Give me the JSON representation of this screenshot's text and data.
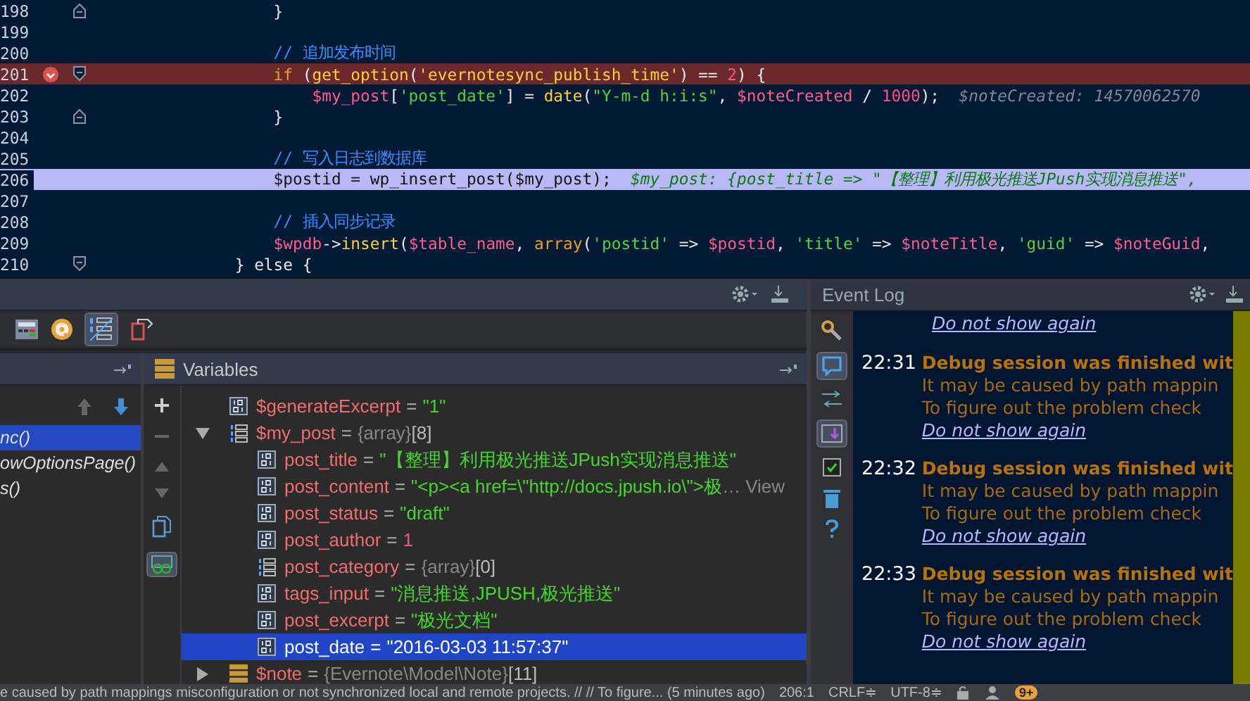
{
  "editor": {
    "lines": [
      {
        "number": "198",
        "breakpoint": false,
        "current": false,
        "fold_open": false,
        "fold_close": true,
        "tokens": [
          {
            "kind": "plain",
            "text": "            }"
          }
        ]
      },
      {
        "number": "199",
        "breakpoint": false,
        "current": false,
        "fold_open": false,
        "fold_close": false
      },
      {
        "number": "200",
        "breakpoint": false,
        "current": false,
        "fold_open": false,
        "fold_close": false,
        "tokens": [
          {
            "kind": "comment",
            "text": "            // 追加发布时间"
          }
        ]
      },
      {
        "number": "201",
        "breakpoint": true,
        "current": false,
        "fold_open": true,
        "fold_close": false,
        "tokens": [
          {
            "kind": "keyword",
            "text": "            if"
          },
          {
            "kind": "plain",
            "text": " ("
          },
          {
            "kind": "func",
            "text": "get_option"
          },
          {
            "kind": "plain",
            "text": "("
          },
          {
            "kind": "func",
            "text": "'evernotesync_publish_time'"
          },
          {
            "kind": "plain",
            "text": ") == "
          },
          {
            "kind": "number",
            "text": "2"
          },
          {
            "kind": "plain",
            "text": ") {"
          }
        ]
      },
      {
        "number": "202",
        "breakpoint": false,
        "current": false,
        "fold_open": false,
        "fold_close": false,
        "tokens": [
          {
            "kind": "var",
            "text": "                $my_post"
          },
          {
            "kind": "plain",
            "text": "["
          },
          {
            "kind": "string",
            "text": "'post_date'"
          },
          {
            "kind": "plain",
            "text": "] = "
          },
          {
            "kind": "func",
            "text": "date"
          },
          {
            "kind": "plain",
            "text": "("
          },
          {
            "kind": "string",
            "text": "\"Y-m-d h:i:s\""
          },
          {
            "kind": "plain",
            "text": ", "
          },
          {
            "kind": "var",
            "text": "$noteCreated"
          },
          {
            "kind": "plain",
            "text": " / "
          },
          {
            "kind": "number",
            "text": "1000"
          },
          {
            "kind": "plain",
            "text": ");"
          },
          {
            "kind": "hint",
            "text": "  $noteCreated: 14570062570"
          }
        ]
      },
      {
        "number": "203",
        "breakpoint": false,
        "current": false,
        "fold_open": false,
        "fold_close": true,
        "tokens": [
          {
            "kind": "plain",
            "text": "            }"
          }
        ]
      },
      {
        "number": "204",
        "breakpoint": false,
        "current": false,
        "fold_open": false,
        "fold_close": false
      },
      {
        "number": "205",
        "breakpoint": false,
        "current": false,
        "fold_open": false,
        "fold_close": false,
        "tokens": [
          {
            "kind": "comment",
            "text": "            // 写入日志到数据库"
          }
        ]
      },
      {
        "number": "206",
        "breakpoint": false,
        "current": true,
        "fold_open": false,
        "fold_close": false,
        "tokens": [
          {
            "kind": "plain",
            "text": "            $postid = wp_insert_post($my_post);"
          },
          {
            "kind": "value-hint",
            "text": "  $my_post: {post_title => \"【整理】利用极光推送JPush实现消息推送\","
          }
        ]
      },
      {
        "number": "207",
        "breakpoint": false,
        "current": false,
        "fold_open": false,
        "fold_close": false
      },
      {
        "number": "208",
        "breakpoint": false,
        "current": false,
        "fold_open": false,
        "fold_close": false,
        "tokens": [
          {
            "kind": "comment",
            "text": "            // 插入同步记录"
          }
        ]
      },
      {
        "number": "209",
        "breakpoint": false,
        "current": false,
        "fold_open": false,
        "fold_close": false,
        "tokens": [
          {
            "kind": "var",
            "text": "            $wpdb"
          },
          {
            "kind": "plain",
            "text": "->"
          },
          {
            "kind": "func",
            "text": "insert"
          },
          {
            "kind": "plain",
            "text": "("
          },
          {
            "kind": "var",
            "text": "$table_name"
          },
          {
            "kind": "plain",
            "text": ", "
          },
          {
            "kind": "keyword",
            "text": "array"
          },
          {
            "kind": "plain",
            "text": "("
          },
          {
            "kind": "string",
            "text": "'postid'"
          },
          {
            "kind": "plain",
            "text": " => "
          },
          {
            "kind": "var",
            "text": "$postid"
          },
          {
            "kind": "plain",
            "text": ", "
          },
          {
            "kind": "string",
            "text": "'title'"
          },
          {
            "kind": "plain",
            "text": " => "
          },
          {
            "kind": "var",
            "text": "$noteTitle"
          },
          {
            "kind": "plain",
            "text": ", "
          },
          {
            "kind": "string",
            "text": "'guid'"
          },
          {
            "kind": "plain",
            "text": " => "
          },
          {
            "kind": "var",
            "text": "$noteGuid"
          },
          {
            "kind": "plain",
            "text": ","
          }
        ]
      },
      {
        "number": "210",
        "breakpoint": false,
        "current": false,
        "fold_open": true,
        "fold_close": false,
        "tokens": [
          {
            "kind": "plain",
            "text": "        } else {"
          }
        ]
      }
    ]
  },
  "frames": {
    "items": [
      {
        "label": "nc()",
        "selected": true
      },
      {
        "label": "owOptionsPage()",
        "selected": false
      },
      {
        "label": "s()",
        "selected": false
      }
    ]
  },
  "variables": {
    "title": "Variables",
    "rows": [
      {
        "name": "$generateExcerpt",
        "kind": "scalar",
        "operator": "=",
        "value": {
          "kind": "string",
          "text": "\"1\""
        },
        "selected": false
      },
      {
        "name": "$my_post",
        "kind": "array",
        "operator": "=",
        "value": {
          "kind": "type",
          "text": "{array}"
        },
        "count": "[8]",
        "expanded": true,
        "selected": false,
        "children": [
          {
            "name": "post_title",
            "kind": "scalar",
            "operator": "=",
            "value": {
              "kind": "string",
              "text": "\"【整理】利用极光推送JPush实现消息推送\""
            },
            "selected": false
          },
          {
            "name": "post_content",
            "kind": "scalar",
            "operator": "=",
            "value": {
              "kind": "string",
              "text": "\"<p><a href=\\\"http://docs.jpush.io\\\">极"
            },
            "more": "… View",
            "selected": false
          },
          {
            "name": "post_status",
            "kind": "scalar",
            "operator": "=",
            "value": {
              "kind": "string",
              "text": "\"draft\""
            },
            "selected": false
          },
          {
            "name": "post_author",
            "kind": "scalar",
            "operator": "=",
            "value": {
              "kind": "number",
              "text": "1"
            },
            "selected": false
          },
          {
            "name": "post_category",
            "kind": "array",
            "operator": "=",
            "value": {
              "kind": "type",
              "text": "{array}"
            },
            "count": "[0]",
            "selected": false
          },
          {
            "name": "tags_input",
            "kind": "scalar",
            "operator": "=",
            "value": {
              "kind": "string",
              "text": "\"消息推送,JPUSH,极光推送\""
            },
            "selected": false
          },
          {
            "name": "post_excerpt",
            "kind": "scalar",
            "operator": "=",
            "value": {
              "kind": "string",
              "text": "\"极光文档\""
            },
            "selected": false
          },
          {
            "name": "post_date",
            "kind": "scalar",
            "operator": "=",
            "value": {
              "kind": "string",
              "text": "\"2016-03-03 11:57:37\""
            },
            "selected": true
          }
        ]
      },
      {
        "name": "$note",
        "kind": "object",
        "operator": "=",
        "value": {
          "kind": "type",
          "text": "{Evernote\\Model\\Note}"
        },
        "count": "[11]",
        "expanded": false,
        "selected": false
      }
    ]
  },
  "event_log": {
    "title": "Event Log",
    "top_link": "Do not show again",
    "entries": [
      {
        "time": "22:31",
        "title": "Debug session was finished wit",
        "lines": [
          "It may be caused by path mappin",
          "To figure out the problem check"
        ],
        "link": "Do not show again"
      },
      {
        "time": "22:32",
        "title": "Debug session was finished wit",
        "lines": [
          "It may be caused by path mappin",
          "To figure out the problem check"
        ],
        "link": "Do not show again"
      },
      {
        "time": "22:33",
        "title": "Debug session was finished wit",
        "lines": [
          "It may be caused by path mappin",
          "To figure out the problem check"
        ],
        "link": "Do not show again"
      }
    ]
  },
  "status_bar": {
    "message": "e caused by path mappings misconfiguration or not synchronized local and remote projects. // // To figure... (5 minutes ago)",
    "position": "206:1",
    "line_separator": "CRLF≑",
    "encoding": "UTF-8≑",
    "badge": "9+"
  }
}
